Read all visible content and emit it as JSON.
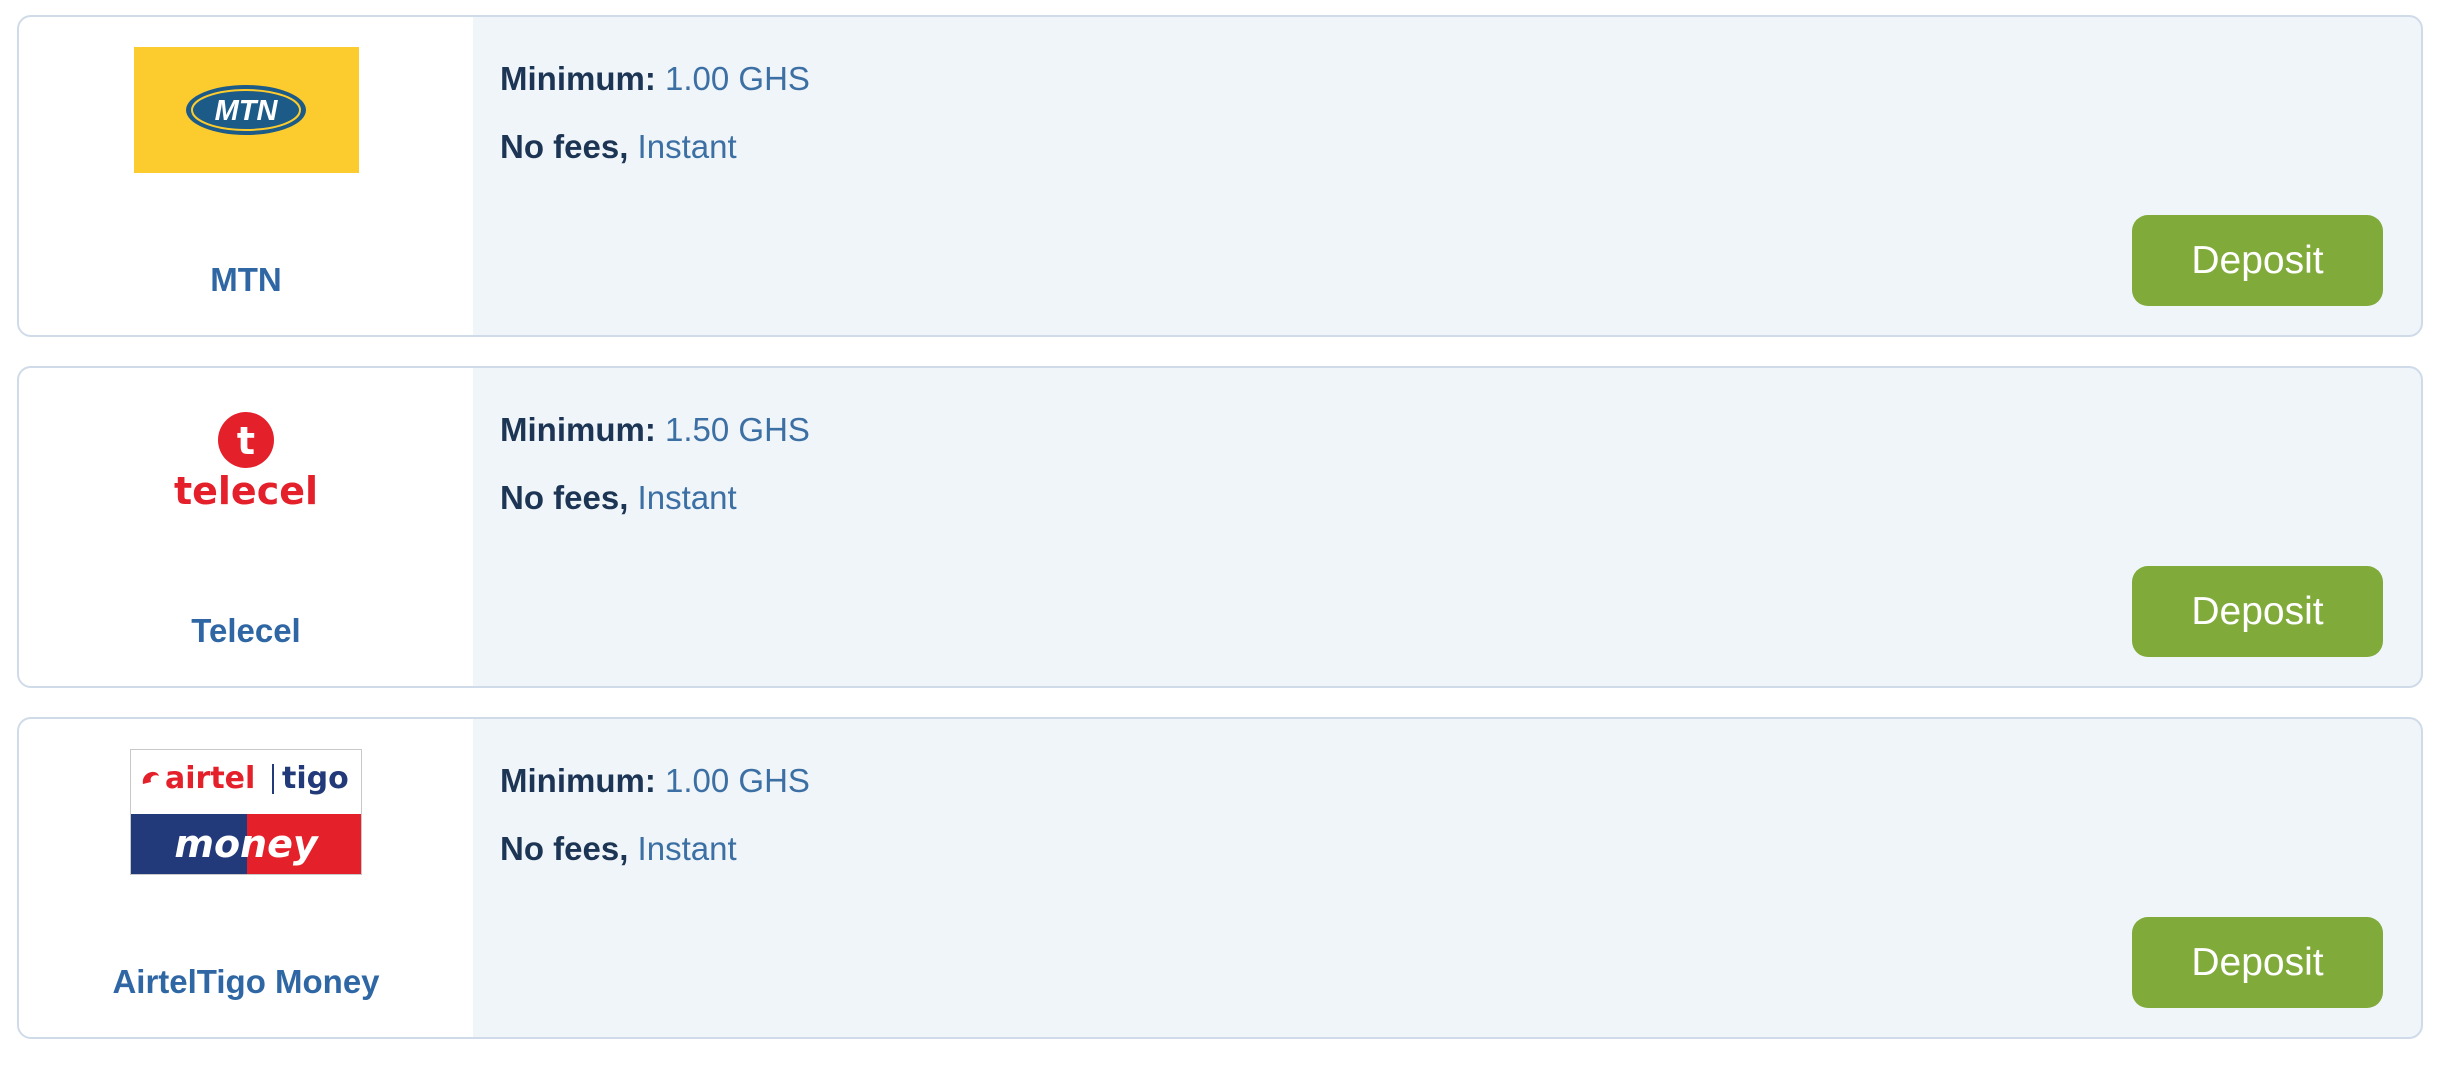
{
  "payment_methods": [
    {
      "name": "MTN",
      "logo_text": "MTN",
      "minimum_label": "Minimum:",
      "minimum_value": "1.00 GHS",
      "fees_label": "No fees,",
      "speed": "Instant",
      "button_label": "Deposit"
    },
    {
      "name": "Telecel",
      "logo_text": "telecel",
      "logo_mark": "t",
      "minimum_label": "Minimum:",
      "minimum_value": "1.50 GHS",
      "fees_label": "No fees,",
      "speed": "Instant",
      "button_label": "Deposit"
    },
    {
      "name": "AirtelTigo Money",
      "logo_text_top_left": "airtel",
      "logo_text_top_right": "tigo",
      "logo_text_bottom": "money",
      "minimum_label": "Minimum:",
      "minimum_value": "1.00 GHS",
      "fees_label": "No fees,",
      "speed": "Instant",
      "button_label": "Deposit"
    }
  ],
  "colors": {
    "button": "#80ab3a",
    "method_name": "#2f67a5",
    "card_background": "#f0f5fa",
    "mtn_yellow": "#fccb2d",
    "telecel_red": "#e4202b",
    "airtel_red": "#e4202b",
    "money_navy": "#233a7a"
  }
}
